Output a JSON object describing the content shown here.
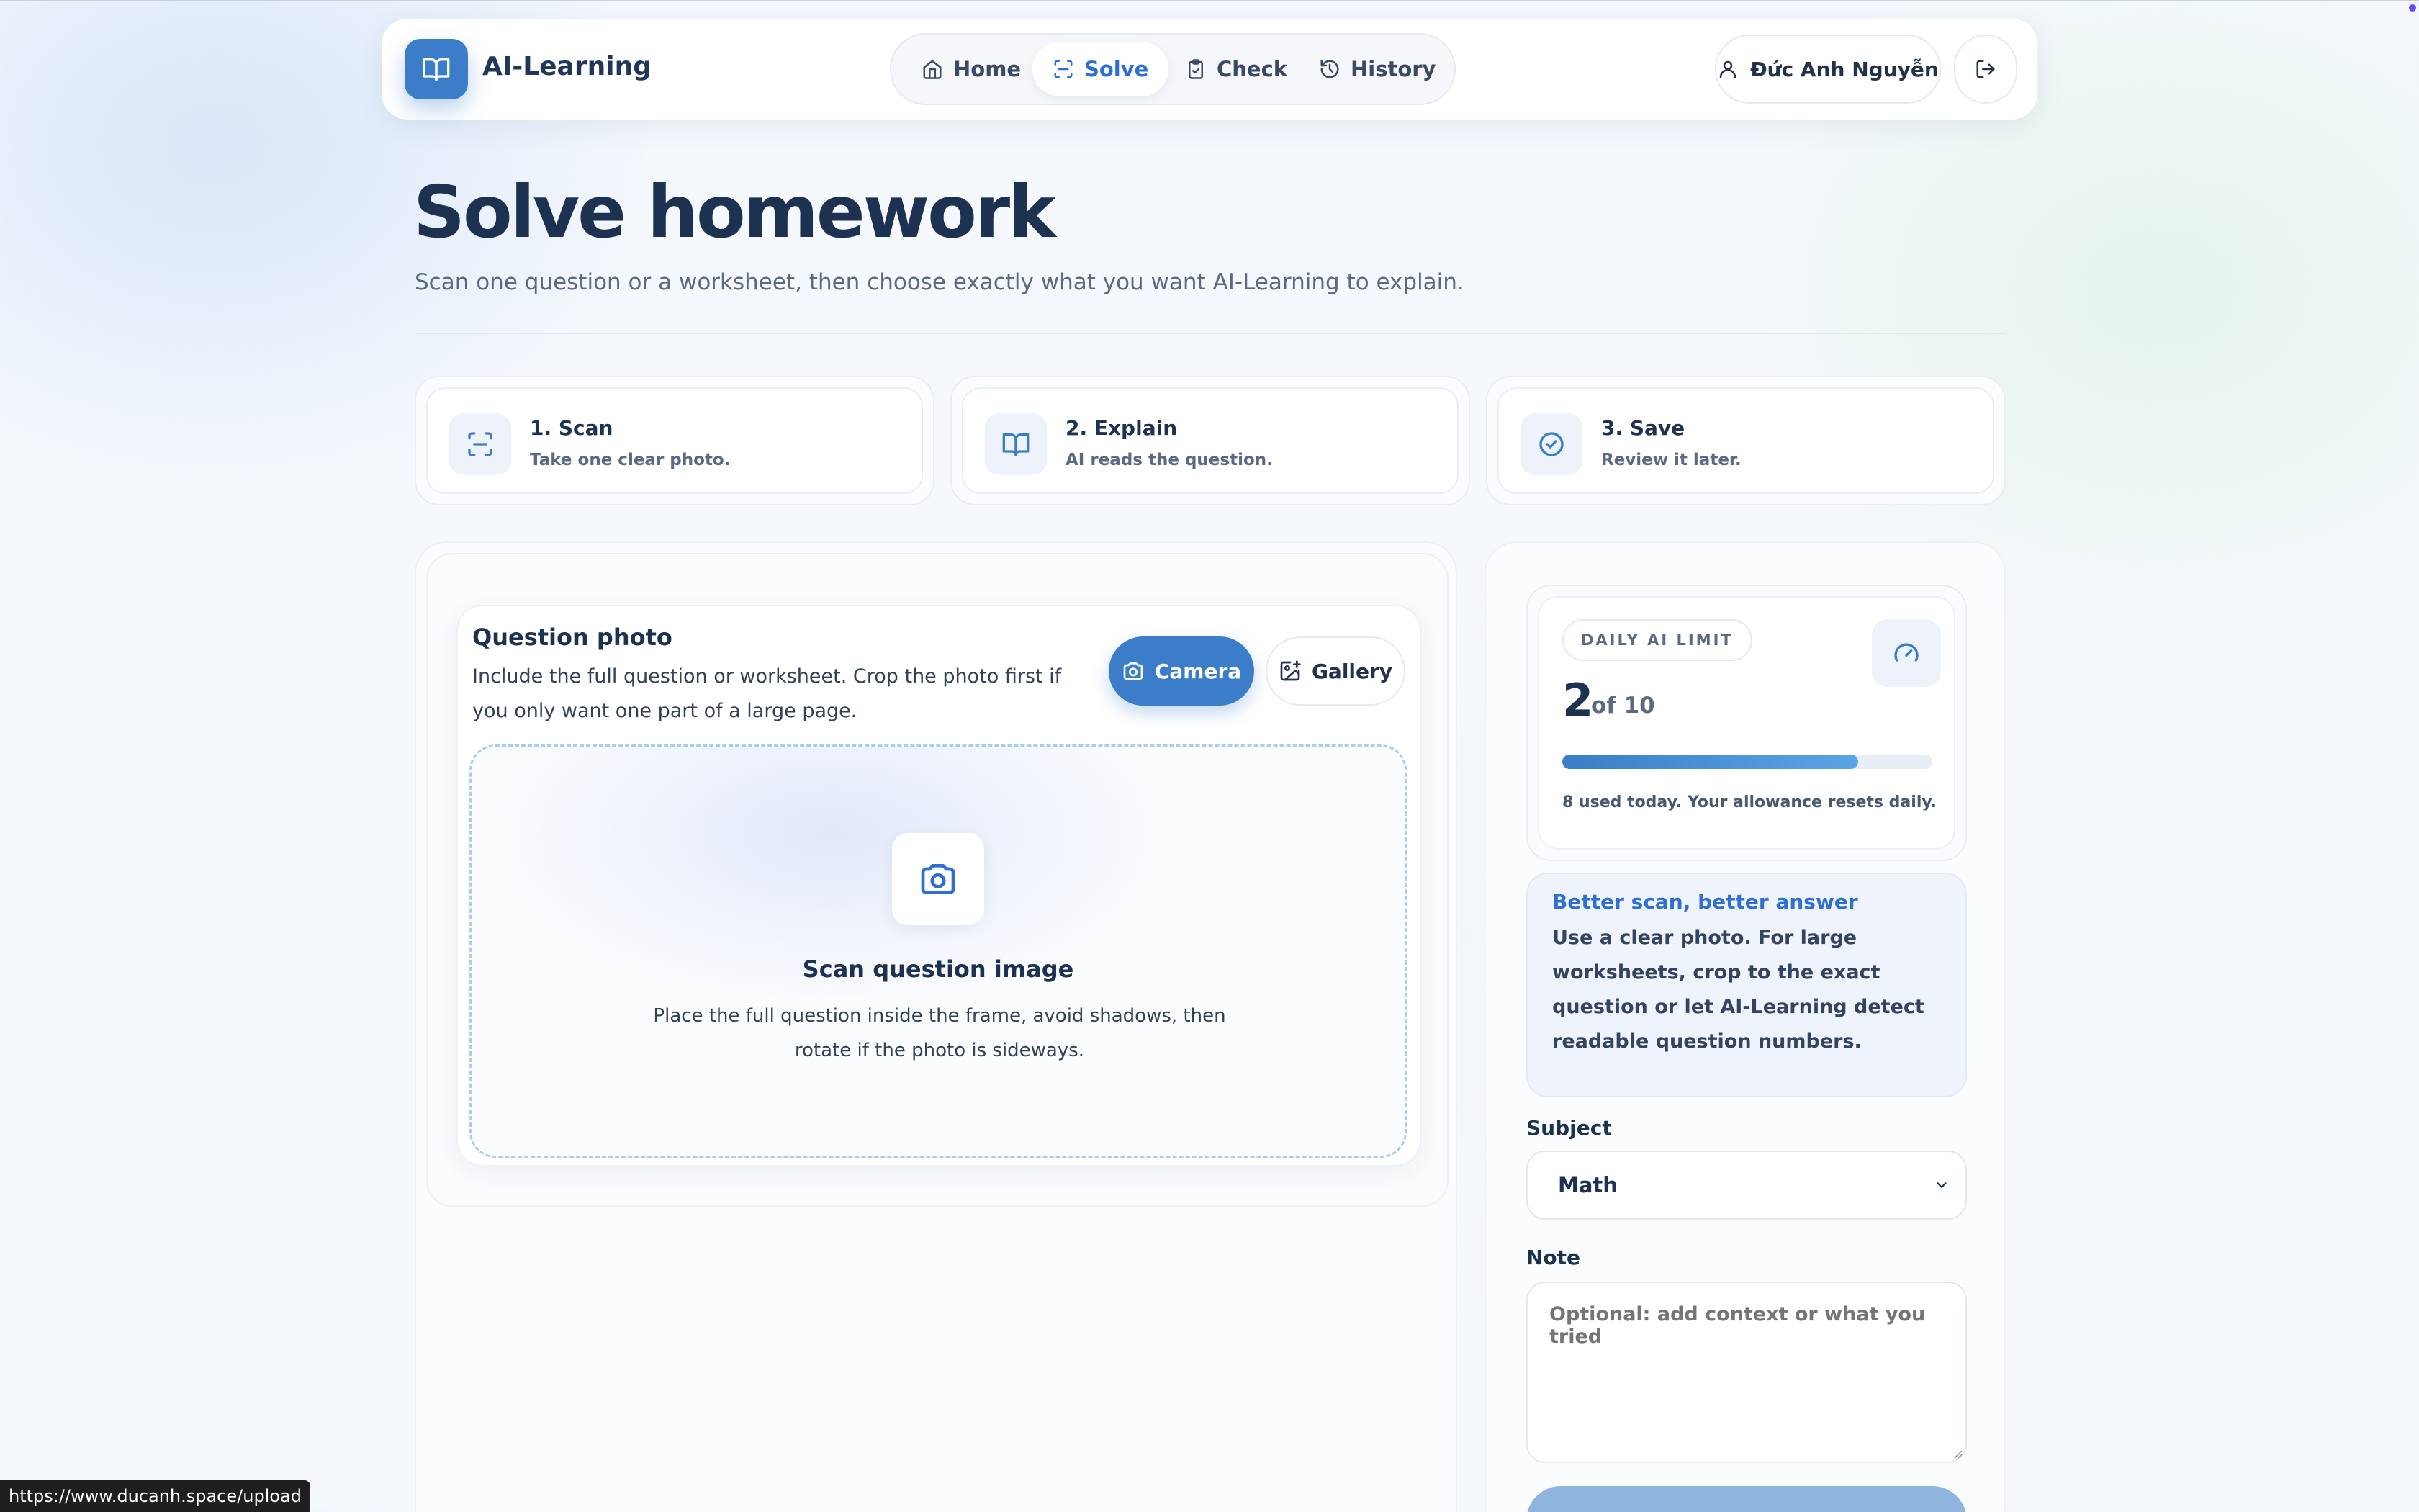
{
  "brand": {
    "name": "AI-Learning"
  },
  "nav": {
    "items": [
      {
        "label": "Home",
        "icon": "home-icon",
        "active": false
      },
      {
        "label": "Solve",
        "icon": "scan-icon",
        "active": true
      },
      {
        "label": "Check",
        "icon": "clipboard-check-icon",
        "active": false
      },
      {
        "label": "History",
        "icon": "history-icon",
        "active": false
      }
    ],
    "user_name": "Đức Anh Nguyễn",
    "logout_icon": "logout-icon"
  },
  "page": {
    "title": "Solve homework",
    "subtitle": "Scan one question or a worksheet, then choose exactly what you want AI-Learning to explain."
  },
  "steps": [
    {
      "title": "1. Scan",
      "desc": "Take one clear photo.",
      "icon": "scan-icon"
    },
    {
      "title": "2. Explain",
      "desc": "AI reads the question.",
      "icon": "book-icon"
    },
    {
      "title": "3. Save",
      "desc": "Review it later.",
      "icon": "check-circle-icon"
    }
  ],
  "photo": {
    "title": "Question photo",
    "desc": "Include the full question or worksheet. Crop the photo first if you only want one part of a large page.",
    "camera_label": "Camera",
    "gallery_label": "Gallery",
    "dropzone_title": "Scan question image",
    "dropzone_desc": "Place the full question inside the frame, avoid shadows, then rotate if the photo is sideways."
  },
  "limit": {
    "badge": "DAILY AI LIMIT",
    "remaining": "2",
    "of_text": "of 10",
    "used_fraction": 0.8,
    "note": "8 used today. Your allowance resets daily."
  },
  "tip": {
    "title": "Better scan, better answer",
    "text": "Use a clear photo. For large worksheets, crop to the exact question or let AI-Learning detect readable question numbers."
  },
  "form": {
    "subject_label": "Subject",
    "subject_value": "Math",
    "note_label": "Note",
    "note_placeholder": "Optional: add context or what you tried"
  },
  "status_url": "https://www.ducanh.space/upload",
  "colors": {
    "accent": "#3b7dc8",
    "active_nav": "#2f6fd3",
    "title": "#1d3150"
  }
}
